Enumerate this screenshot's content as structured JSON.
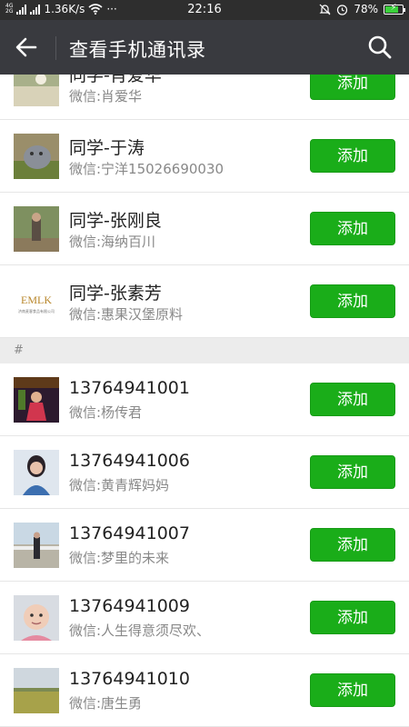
{
  "status_bar": {
    "network": "4G 2G",
    "speed": "1.36K/s",
    "more": "···",
    "time": "22:16",
    "battery": "78%",
    "battery_level": 0.78
  },
  "header": {
    "title": "查看手机通讯录",
    "back_icon": "back-arrow-icon",
    "search_icon": "search-icon"
  },
  "section_header": "#",
  "add_label": "添加",
  "contacts_top": [
    {
      "name": "同学-肖爱华",
      "wechat": "微信:肖爱华"
    },
    {
      "name": "同学-于涛",
      "wechat": "微信:宁洋15026690030"
    },
    {
      "name": "同学-张刚良",
      "wechat": "微信:海纳百川"
    },
    {
      "name": "同学-张素芳",
      "wechat": "微信:惠果汉堡原料",
      "avatar_logo": "EMLK",
      "avatar_logo_sub": "济南麦客食品有限公司"
    }
  ],
  "contacts_hash": [
    {
      "name": "13764941001",
      "wechat": "微信:杨传君"
    },
    {
      "name": "13764941006",
      "wechat": "微信:黄青辉妈妈"
    },
    {
      "name": "13764941007",
      "wechat": "微信:梦里的未来"
    },
    {
      "name": "13764941009",
      "wechat": "微信:人生得意须尽欢、"
    },
    {
      "name": "13764941010",
      "wechat": "微信:唐生勇"
    }
  ]
}
